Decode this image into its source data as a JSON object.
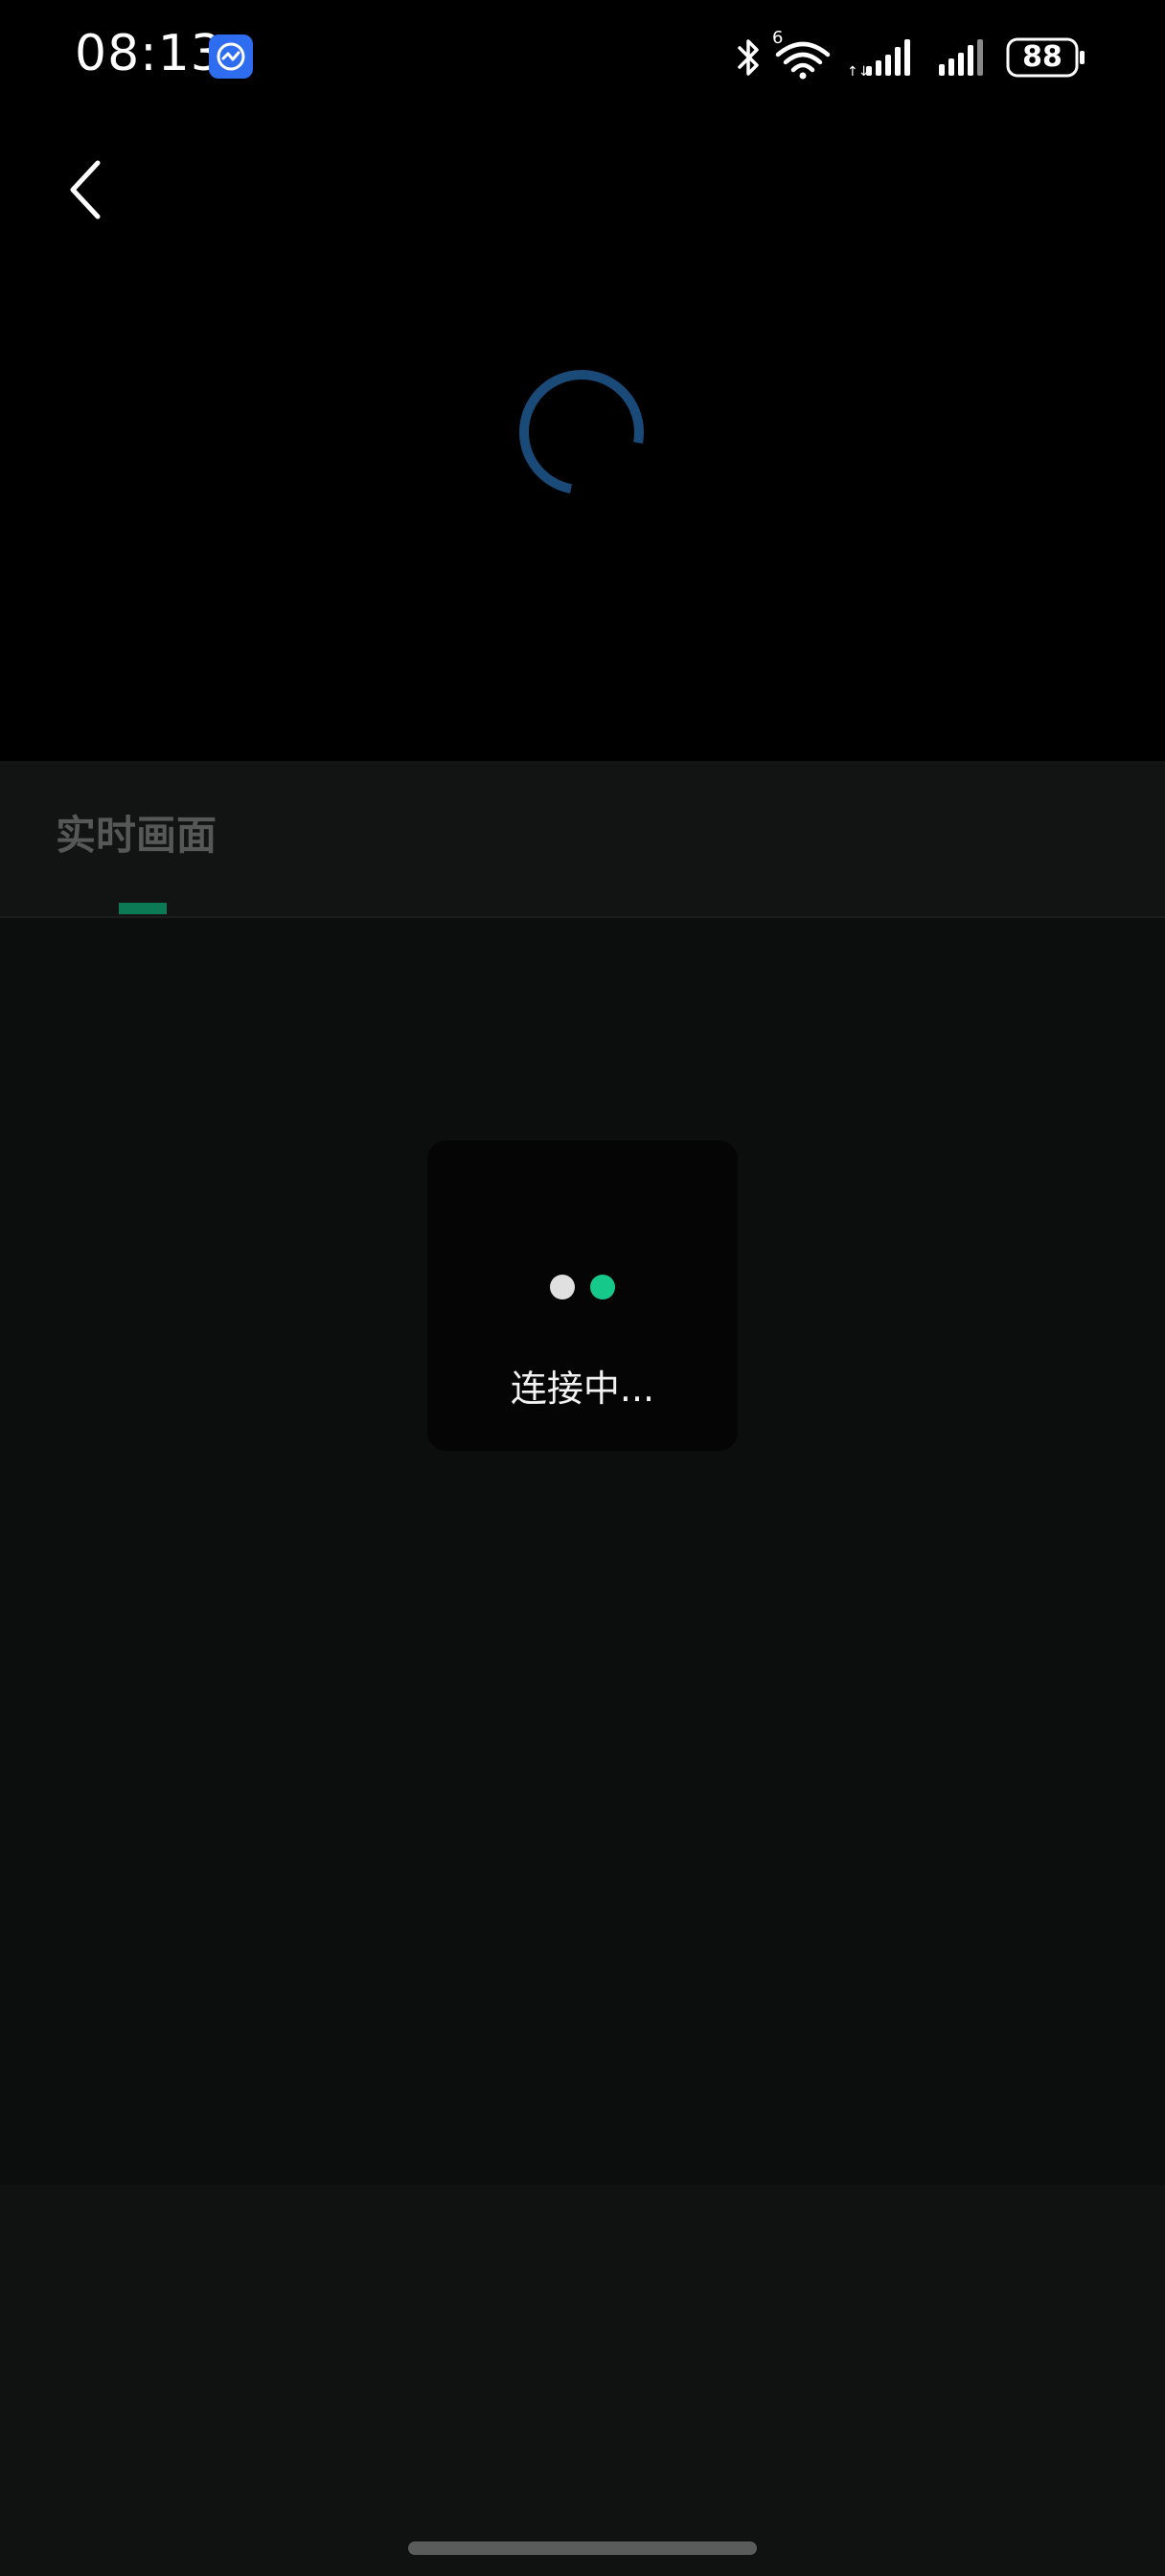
{
  "status_bar": {
    "time": "08:13",
    "app_icon": "meeting-app-icon",
    "icons": [
      "bluetooth-icon",
      "wifi-6-icon",
      "cellular-signal-icon",
      "cellular-signal-icon",
      "battery-icon"
    ],
    "wifi_label": "6",
    "battery_level": "88"
  },
  "header": {
    "back_icon": "chevron-left-icon"
  },
  "video": {
    "spinner_icon": "loading-spinner-icon",
    "spinner_color": "#1a4a78"
  },
  "tabs": [
    {
      "label": "实时画面",
      "active": true
    }
  ],
  "accent_color": "#0c7a55",
  "loading_dialog": {
    "text": "连接中...",
    "dot_colors": [
      "#e0e0e0",
      "#16c98a"
    ]
  }
}
